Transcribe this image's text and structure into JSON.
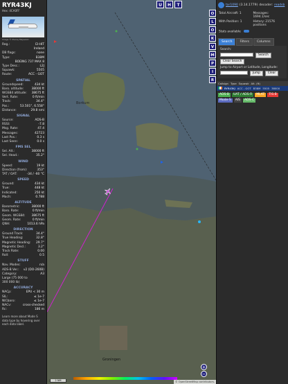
{
  "aircraft": {
    "callsign": "RYR43KJ",
    "hex": "Hex: 4CA0FF",
    "photo_credit": "Image © Maciej Majewski",
    "basic": [
      {
        "k": "Reg.:",
        "v": "EI-HIT"
      },
      {
        "k": "",
        "v": "Ireland"
      },
      {
        "k": "DB flags:",
        "v": "none"
      },
      {
        "k": "Type:",
        "v": "B38M"
      },
      {
        "k": "",
        "v": "BOEING 737 MAX 8"
      },
      {
        "k": "Type Desc.:",
        "v": "L2J"
      },
      {
        "k": "Squawk:",
        "v": "5505"
      },
      {
        "k": "Route:",
        "v": "ACC - GOT"
      }
    ],
    "spatial_title": "Spatial",
    "spatial": [
      {
        "k": "Groundspeed:",
        "v": "434 kt"
      },
      {
        "k": "Baro. altitude:",
        "v": "38000 ft"
      },
      {
        "k": "WGS84 altitude:",
        "v": "38675 ft"
      },
      {
        "k": "Vert. Rate:",
        "v": "0 ft/min"
      },
      {
        "k": "Track:",
        "v": "34.4°"
      },
      {
        "k": "Pos.:",
        "v": "53.501°, 6.558°"
      },
      {
        "k": "Distance:",
        "v": "29.8 nmi"
      }
    ],
    "signal_title": "Signal",
    "signal": [
      {
        "k": "Source:",
        "v": "ADS-B"
      },
      {
        "k": "RSSI:",
        "v": "-7.8"
      },
      {
        "k": "Msg. Rate:",
        "v": "47.4"
      },
      {
        "k": "Messages:",
        "v": "42723"
      },
      {
        "k": "Last Pos.:",
        "v": "0.3 s"
      },
      {
        "k": "Last Seen:",
        "v": "0.0 s"
      }
    ],
    "fms_title": "FMS Sel",
    "fms": [
      {
        "k": "Sel. Alt.:",
        "v": "38000 ft"
      },
      {
        "k": "Sel. Head.:",
        "v": "35.2°"
      }
    ],
    "wind_title": "Wind",
    "wind": [
      {
        "k": "Speed:",
        "v": "19 kt"
      },
      {
        "k": "Direction (from):",
        "v": "353°"
      },
      {
        "k": "TAT / OAT:",
        "v": "-34 / -60 °C"
      }
    ],
    "speed_title": "Speed",
    "speed": [
      {
        "k": "Ground:",
        "v": "434 kt"
      },
      {
        "k": "True:",
        "v": "448 kt"
      },
      {
        "k": "Indicated:",
        "v": "250 kt"
      },
      {
        "k": "Mach:",
        "v": "0.788"
      }
    ],
    "altitude_title": "Altitude",
    "altitude": [
      {
        "k": "Barometric:",
        "v": "38000 ft"
      },
      {
        "k": "Baro. Rate:",
        "v": "0 ft/min"
      },
      {
        "k": "Geom. WGS84:",
        "v": "38675 ft"
      },
      {
        "k": "Geom. Rate:",
        "v": "0 ft/min"
      },
      {
        "k": "QNH:",
        "v": "1013.6 hPa"
      }
    ],
    "direction_title": "Direction",
    "direction": [
      {
        "k": "Ground Track:",
        "v": "34.4°"
      },
      {
        "k": "True Heading:",
        "v": "32.8°"
      },
      {
        "k": "Magnetic Heading:",
        "v": "29.7°"
      },
      {
        "k": "Magnetic Decl.:",
        "v": "3.2°"
      },
      {
        "k": "Track Rate:",
        "v": "0.00"
      },
      {
        "k": "Roll:",
        "v": "0.5"
      }
    ],
    "stuff_title": "Stuff",
    "stuff": [
      {
        "k": "Nav. Modes:",
        "v": "n/a"
      },
      {
        "k": "ADS-B Ver.:",
        "v": "v2 (DO-260B)"
      },
      {
        "k": "Category:",
        "v": "A3"
      },
      {
        "k": "Large (75 000 to",
        "v": ""
      },
      {
        "k": "300 000 lb)",
        "v": ""
      }
    ],
    "accuracy_title": "Accuracy",
    "accuracy": [
      {
        "k": "NACp:",
        "v": "EPU < 30 m"
      },
      {
        "k": "SIL:",
        "v": "≤ 1e-7"
      },
      {
        "k": "NICbaro:",
        "v": "≤ 1e-7"
      },
      {
        "k": "NACv:",
        "v": "cross-checked"
      },
      {
        "k": "Rc:",
        "v": "186 m"
      }
    ],
    "learn_more": "Learn more about Mode S data type by hovering over each data label."
  },
  "map": {
    "top_buttons": [
      "U",
      "H",
      "T"
    ],
    "side_buttons": [
      "O",
      "L",
      "O",
      "K",
      "V",
      "M",
      "P",
      "I",
      "R"
    ],
    "zoom_in": "+",
    "zoom_out": "−",
    "scale": "2 NM",
    "attribution": "© OpenStreetMap contributors.",
    "labels": [
      {
        "id": "borkum",
        "text": "Borkum"
      },
      {
        "id": "groningen",
        "text": "Groningen"
      }
    ]
  },
  "panel": {
    "link": "tar1090",
    "version": "(3.14.1779)",
    "decoder_label": "decoder:",
    "decoder_value": "readsb",
    "stats": [
      {
        "k": "Total Aircraft:",
        "v": "1"
      },
      {
        "k": "Messages:",
        "v": "1694.1/sec"
      },
      {
        "k": "With Position:",
        "v": "1"
      },
      {
        "k": "History:",
        "v": "21576 positions"
      }
    ],
    "stats_available": "Stats available",
    "tabs": [
      "Search",
      "Filters",
      "Columns"
    ],
    "search_label": "Search:",
    "search_button": "Search",
    "clear_search": "Clear Search",
    "jump_label": "Jump to Airport or Latitude, Longitude:",
    "jump_button": "Jump",
    "clear_button": "Clear",
    "table_headers": [
      "Callsign",
      "Type",
      "Squawk",
      "Alt. (ft)"
    ],
    "table_row": {
      "callsign": "RYR43KJ",
      "route": "ACC - GOT",
      "type": "B38M",
      "squawk": "5505",
      "alt": "38000"
    },
    "badges": [
      {
        "text": "ADS-B",
        "color": "#4caf50"
      },
      {
        "text": "UAT / ADS-R",
        "color": "#2e7d32"
      },
      {
        "text": "MLAT",
        "color": "#f9a825"
      },
      {
        "text": "TIS-B",
        "color": "#e53935"
      },
      {
        "text": "Mode-S",
        "color": "#5c6bc0"
      },
      {
        "text": "AIS",
        "color": "#444444"
      },
      {
        "text": "ADS-C",
        "color": "#66bb6a"
      }
    ]
  }
}
